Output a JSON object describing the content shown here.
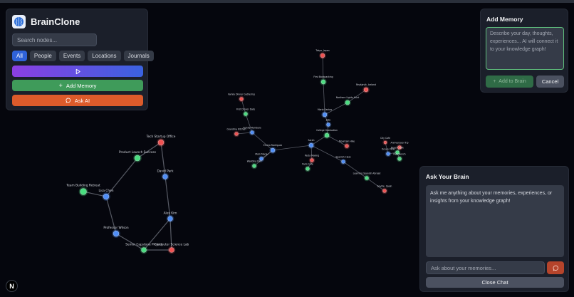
{
  "app": {
    "name": "BrainClone"
  },
  "sidebar": {
    "search_placeholder": "Search nodes...",
    "filters": [
      "All",
      "People",
      "Events",
      "Locations",
      "Journals"
    ],
    "active_filter": "All",
    "play_icon": "play-icon",
    "add_memory_label": "Add Memory",
    "ask_ai_label": "Ask AI"
  },
  "add_memory": {
    "title": "Add Memory",
    "placeholder": "Describe your day, thoughts, experiences... AI will connect it to your knowledge graph!",
    "add_button": "Add to Brain",
    "cancel_button": "Cancel"
  },
  "ask_brain": {
    "title": "Ask Your Brain",
    "intro": "Ask me anything about your memories, experiences, or insights from your knowledge graph!",
    "input_placeholder": "Ask about your memories...",
    "close_button": "Close Chat"
  },
  "colors": {
    "person": "#4f8ef7",
    "event": "#4ade80",
    "location": "#f05252",
    "accent_purple": "#8b3fe3",
    "accent_green": "#3f9b5a",
    "accent_orange": "#dc5b2b"
  },
  "badge": "N",
  "graph": {
    "nodes": [
      {
        "id": "tech_office",
        "label": "Tech Startup Office",
        "type": "location"
      },
      {
        "id": "product_launch",
        "label": "Product Launch Success",
        "type": "event"
      },
      {
        "id": "david",
        "label": "David Park",
        "type": "person"
      },
      {
        "id": "team_retreat",
        "label": "Team Building Retreat",
        "type": "event"
      },
      {
        "id": "lisa",
        "label": "Lisa Chen",
        "type": "person"
      },
      {
        "id": "alex",
        "label": "Alex Kim",
        "type": "person"
      },
      {
        "id": "prof_wilson",
        "label": "Professor Wilson",
        "type": "person"
      },
      {
        "id": "senior_project",
        "label": "Senior Capstone Project",
        "type": "event"
      },
      {
        "id": "cs_lab",
        "label": "Computer Science Lab",
        "type": "location"
      },
      {
        "id": "tokyo",
        "label": "Tokyo, Japan",
        "type": "location"
      },
      {
        "id": "first_backpacking",
        "label": "First Backpacking",
        "type": "event"
      },
      {
        "id": "reykjavik",
        "label": "Reykjavik, Iceland",
        "type": "location"
      },
      {
        "id": "northern_lights",
        "label": "Northern Lights Hunt",
        "type": "event"
      },
      {
        "id": "maria",
        "label": "Maria Santos",
        "type": "person"
      },
      {
        "id": "jake",
        "label": "Jake",
        "type": "person"
      },
      {
        "id": "college_grad",
        "label": "College Graduation",
        "type": "event"
      },
      {
        "id": "mountain_hike",
        "label": "Mountain Hike",
        "type": "location"
      },
      {
        "id": "sarah",
        "label": "Sarah",
        "type": "person"
      },
      {
        "id": "emma",
        "label": "Emma Rodriguez",
        "type": "person"
      },
      {
        "id": "pasta_making",
        "label": "Pasta Making",
        "type": "location"
      },
      {
        "id": "paris_cafe",
        "label": "Paris Cafe",
        "type": "event"
      },
      {
        "id": "spanish_class",
        "label": "Spanish Class",
        "type": "person"
      },
      {
        "id": "learning_spanish",
        "label": "Learning Spanish Abroad",
        "type": "event"
      },
      {
        "id": "seville",
        "label": "Seville, Spain",
        "type": "location"
      },
      {
        "id": "family_dinner",
        "label": "Family Dinner Gathering",
        "type": "location"
      },
      {
        "id": "first_date",
        "label": "First Dinner Date",
        "type": "event"
      },
      {
        "id": "family_members",
        "label": "Family Members",
        "type": "person"
      },
      {
        "id": "grandma_kitchen",
        "label": "Grandma Kitchen",
        "type": "location"
      },
      {
        "id": "mom_maria",
        "label": "Mom Maria",
        "type": "person"
      },
      {
        "id": "wedding_day",
        "label": "Wedding Day",
        "type": "event"
      },
      {
        "id": "anniversary",
        "label": "Anniversary Trip",
        "type": "location"
      },
      {
        "id": "beach_walk",
        "label": "Beach Walk",
        "type": "event"
      },
      {
        "id": "ocean_view",
        "label": "Ocean View",
        "type": "person"
      },
      {
        "id": "park_bench",
        "label": "Park Bench",
        "type": "event"
      },
      {
        "id": "city_cafe",
        "label": "City Cafe",
        "type": "location"
      }
    ]
  }
}
